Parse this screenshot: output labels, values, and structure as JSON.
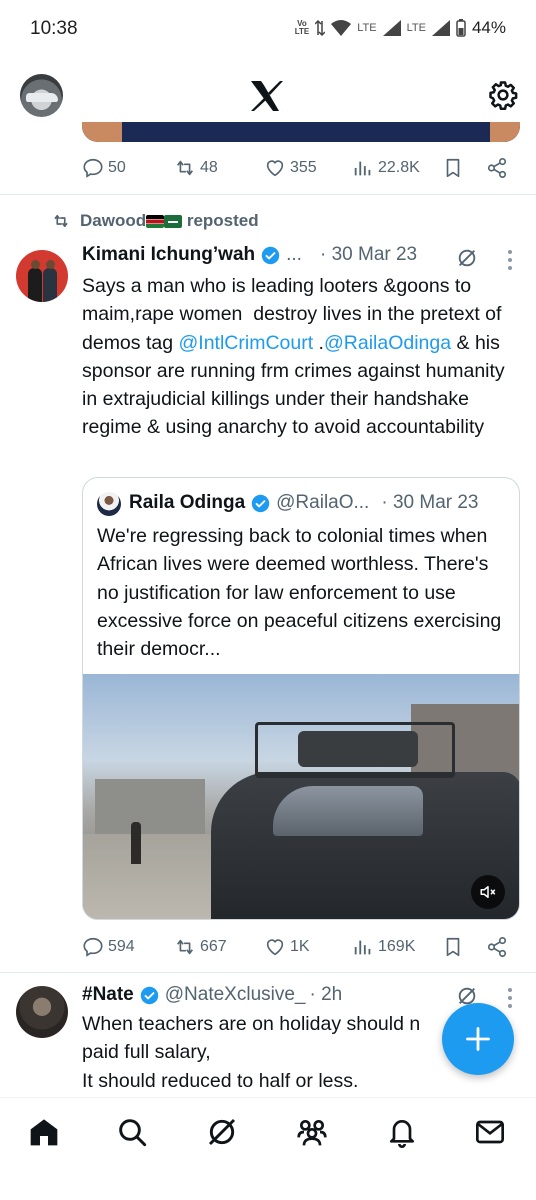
{
  "status_bar": {
    "time": "10:38",
    "volte": "Vo LTE",
    "lte1": "LTE",
    "lte2": "LTE",
    "battery": "44%"
  },
  "header": {
    "logo_icon": "x-logo-icon",
    "settings_icon": "gear-icon"
  },
  "prev_tweet": {
    "replies": "50",
    "reposts": "48",
    "likes": "355",
    "views": "22.8K"
  },
  "tweet1": {
    "reposted_by": "Dawood",
    "reposted_label": "reposted",
    "name": "Kimani Ichung’wah",
    "handle_trunc": "...",
    "time": "· 30 Mar 23",
    "text_part1": "Says a man who is leading looters &goons to maim,rape women  destroy lives in the pretext of demos tag ",
    "mention1": "@IntlCrimCourt",
    "text_part2": " .",
    "mention2": "@RailaOdinga",
    "text_part3": " & his sponsor are running frm crimes against humanity in extrajudicial killings under their handshake regime & using anarchy to avoid accountability",
    "quote": {
      "name": "Raila Odinga",
      "handle": "@RailaO...",
      "time": "· 30 Mar 23",
      "text": "We're regressing back to colonial times when African lives were deemed worthless. There's no justification for law enforcement to use excessive force on peaceful citizens exercising their democr..."
    },
    "replies": "594",
    "reposts": "667",
    "likes": "1K",
    "views": "169K"
  },
  "tweet2": {
    "name": "#Nate",
    "handle": "@NateXclusive_",
    "time": "· 2h",
    "text": "When teachers are on holiday should n\npaid full salary,\nIt should reduced to half or less."
  },
  "bottom_nav": [
    "home-icon",
    "search-icon",
    "grok-icon",
    "communities-icon",
    "notifications-icon",
    "messages-icon"
  ],
  "colors": {
    "accent": "#1d9bf0",
    "text": "#0f1419",
    "muted": "#536471"
  }
}
